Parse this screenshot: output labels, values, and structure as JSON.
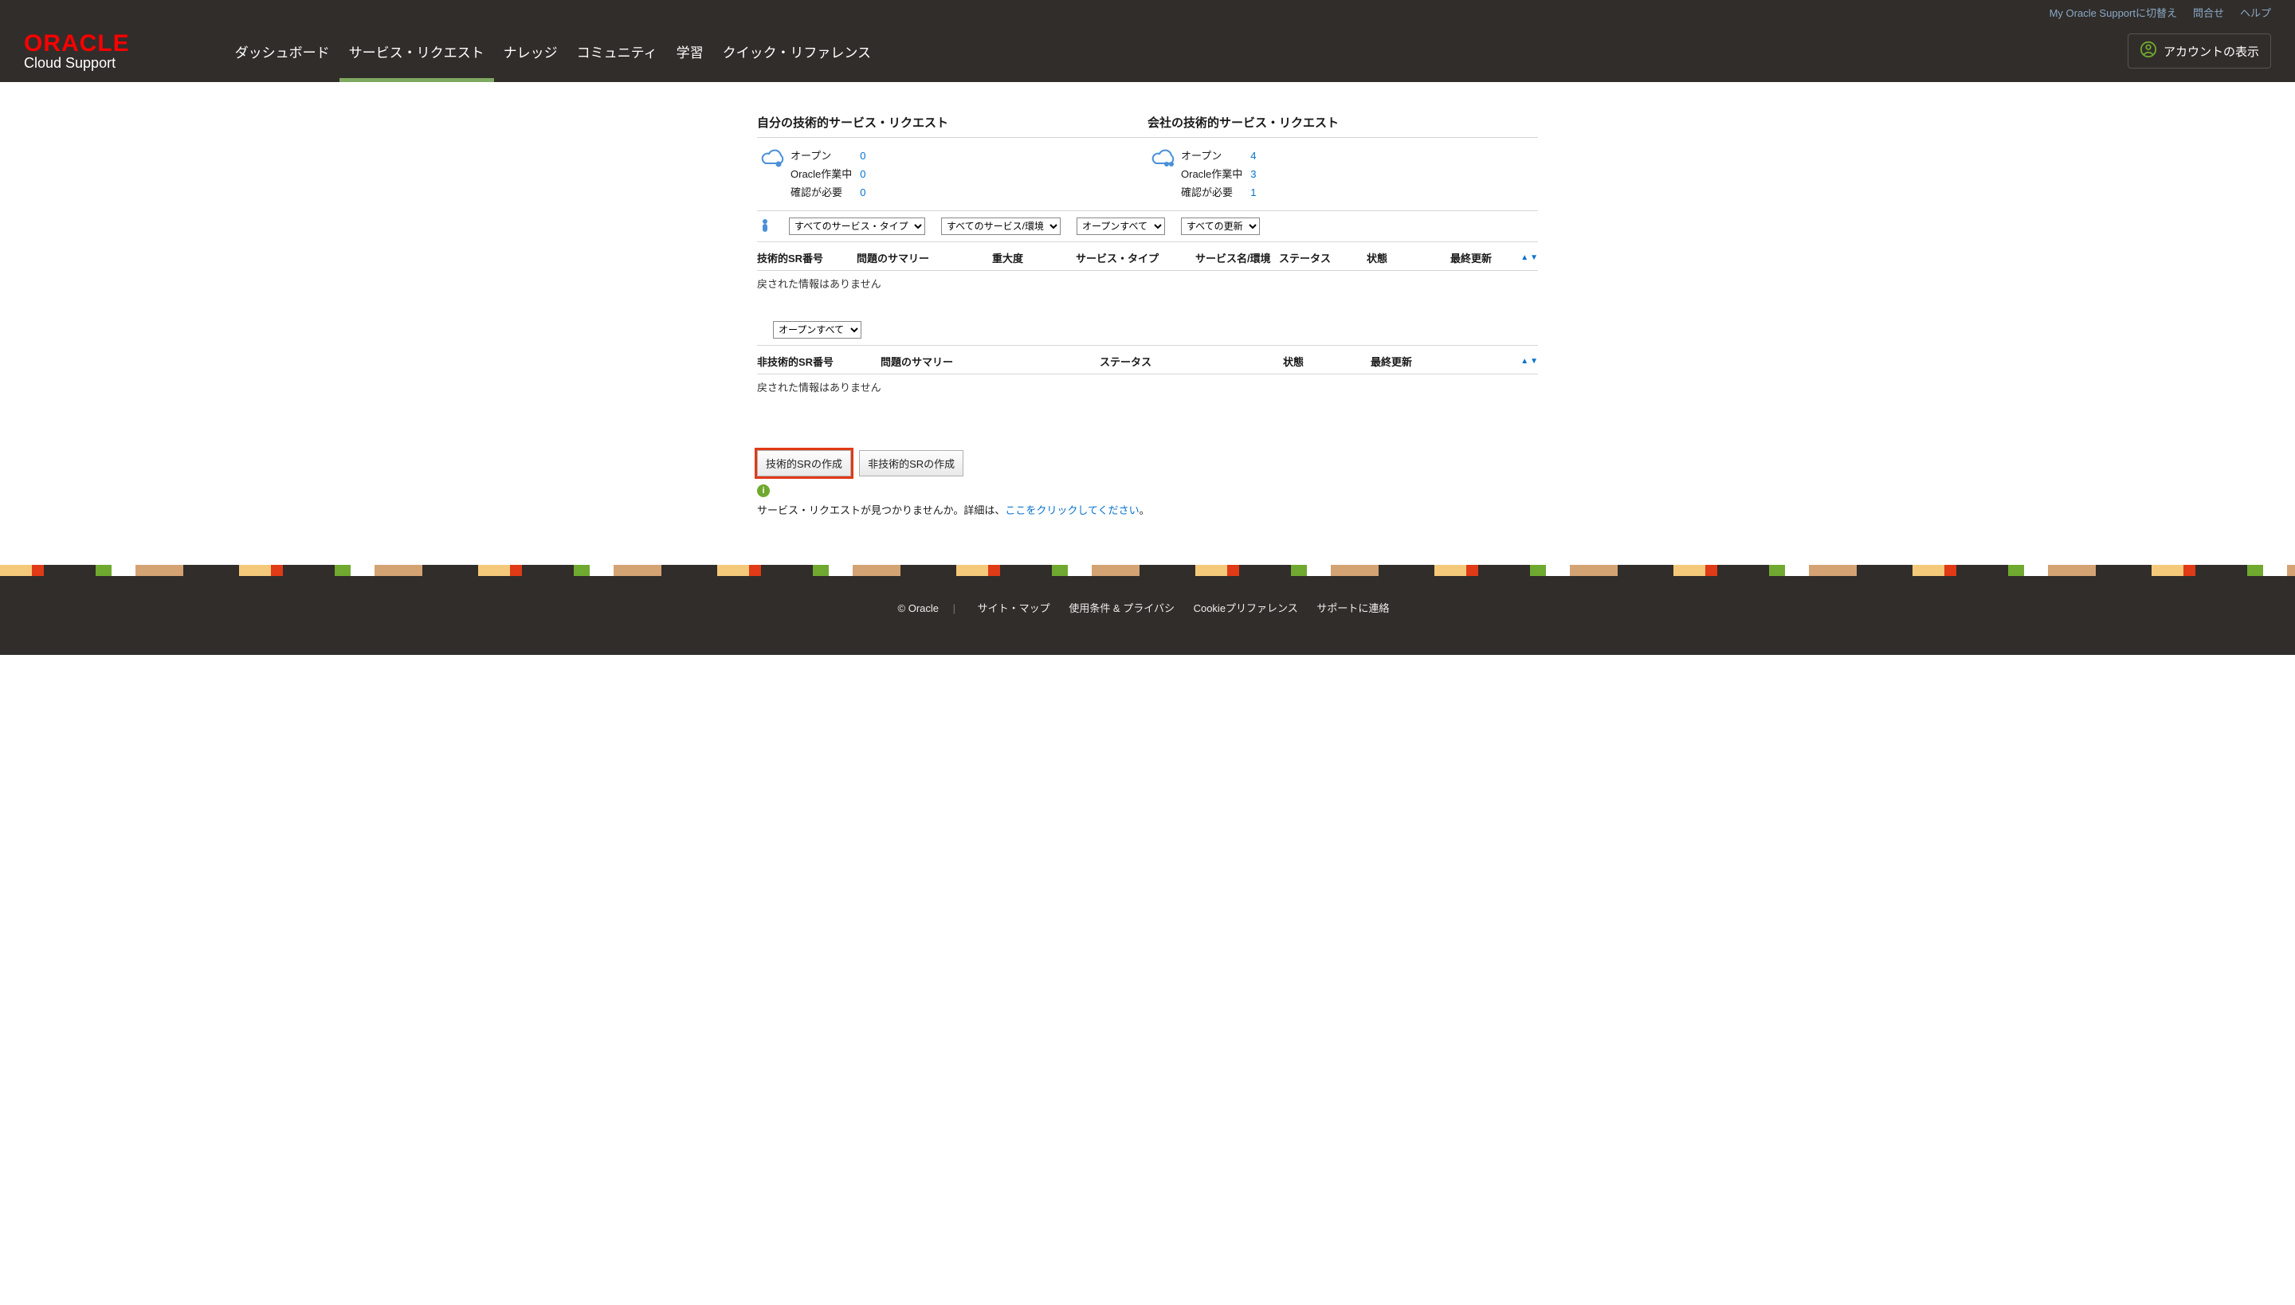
{
  "topbar": {
    "switch_link": "My Oracle Supportに切替え",
    "contact": "問合せ",
    "help": "ヘルプ"
  },
  "logo": {
    "brand": "ORACLE",
    "sub": "Cloud Support"
  },
  "nav": {
    "items": [
      {
        "label": "ダッシュボード",
        "active": false
      },
      {
        "label": "サービス・リクエスト",
        "active": true
      },
      {
        "label": "ナレッジ",
        "active": false
      },
      {
        "label": "コミュニティ",
        "active": false
      },
      {
        "label": "学習",
        "active": false
      },
      {
        "label": "クイック・リファレンス",
        "active": false
      }
    ],
    "account": "アカウントの表示"
  },
  "sections": {
    "own": {
      "title": "自分の技術的サービス・リクエスト",
      "rows": [
        {
          "label": "オープン",
          "value": "0"
        },
        {
          "label": "Oracle作業中",
          "value": "0"
        },
        {
          "label": "確認が必要",
          "value": "0"
        }
      ]
    },
    "company": {
      "title": "会社の技術的サービス・リクエスト",
      "rows": [
        {
          "label": "オープン",
          "value": "4"
        },
        {
          "label": "Oracle作業中",
          "value": "3"
        },
        {
          "label": "確認が必要",
          "value": "1"
        }
      ]
    }
  },
  "filters": {
    "service_type": "すべてのサービス・タイプ",
    "service_env": "すべてのサービス/環境",
    "open_all": "オープンすべて",
    "update_all": "すべての更新"
  },
  "table1": {
    "cols": [
      "技術的SR番号",
      "問題のサマリー",
      "重大度",
      "サービス・タイプ",
      "サービス名/環境",
      "ステータス",
      "状態",
      "最終更新"
    ],
    "no_data": "戻された情報はありません"
  },
  "filter2": {
    "open_all": "オープンすべて"
  },
  "table2": {
    "cols": [
      "非技術的SR番号",
      "問題のサマリー",
      "ステータス",
      "状態",
      "最終更新"
    ],
    "no_data": "戻された情報はありません"
  },
  "buttons": {
    "create_tech": "技術的SRの作成",
    "create_nontech": "非技術的SRの作成"
  },
  "info": {
    "prefix": "サービス・リクエストが見つかりませんか。詳細は、",
    "link": "ここをクリックしてください",
    "suffix": "。"
  },
  "footer": {
    "copyright": "© Oracle",
    "links": [
      "サイト・マップ",
      "使用条件 & プライバシ",
      "Cookieプリファレンス",
      "サポートに連絡"
    ]
  }
}
